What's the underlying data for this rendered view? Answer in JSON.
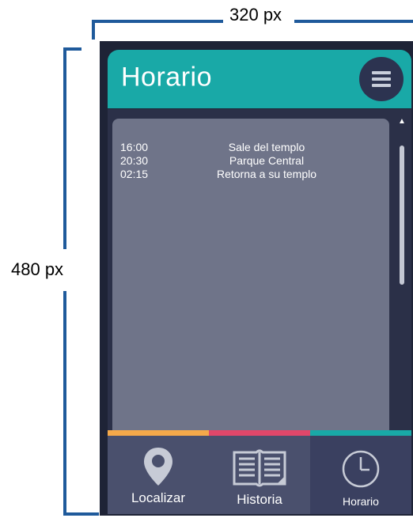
{
  "annotations": {
    "width_label": "320 px",
    "height_label": "480 px"
  },
  "app": {
    "title": "Horario",
    "menu_icon": "hamburger-icon"
  },
  "schedule": [
    {
      "time": "16:00",
      "event": "Sale del templo"
    },
    {
      "time": "20:30",
      "event": "Parque Central"
    },
    {
      "time": "02:15",
      "event": "Retorna a su templo"
    }
  ],
  "tabs": [
    {
      "label": "Localizar",
      "icon": "location-pin-icon",
      "accent": "#f5a94a"
    },
    {
      "label": "Historia",
      "icon": "book-icon",
      "accent": "#e0476a"
    },
    {
      "label": "Horario",
      "icon": "clock-icon",
      "accent": "#19a9a7",
      "active": true
    }
  ],
  "colors": {
    "header": "#19a9a7",
    "background": "#1e2336",
    "panel": "#6f7489",
    "tab_bg": "#4a506d",
    "tab_active_bg": "#3a4060"
  }
}
